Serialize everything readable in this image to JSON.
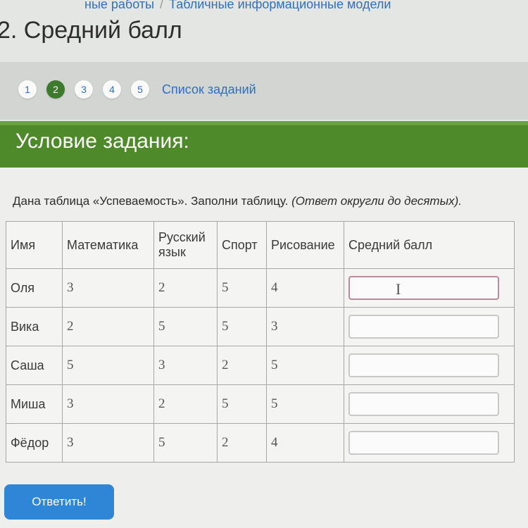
{
  "breadcrumb": {
    "prev": "ные работы",
    "separator": "/",
    "current": "Табличные информационные модели"
  },
  "page_title": "2. Средний балл",
  "pager": {
    "pages": [
      "1",
      "2",
      "3",
      "4",
      "5"
    ],
    "active_page": "2",
    "tasks_link": "Список заданий"
  },
  "section_header": "Условие задания:",
  "task": {
    "text": "Дана таблица «Успеваемость». Заполни таблицу.",
    "note": "(Ответ округли до десятых)."
  },
  "table": {
    "headers": [
      "Имя",
      "Математика",
      "Русский язык",
      "Спорт",
      "Рисование",
      "Средний балл"
    ],
    "rows": [
      {
        "name": "Оля",
        "values": [
          "3",
          "2",
          "5",
          "4"
        ],
        "answer": ""
      },
      {
        "name": "Вика",
        "values": [
          "2",
          "5",
          "5",
          "3"
        ],
        "answer": ""
      },
      {
        "name": "Саша",
        "values": [
          "5",
          "3",
          "2",
          "5"
        ],
        "answer": ""
      },
      {
        "name": "Миша",
        "values": [
          "3",
          "2",
          "5",
          "5"
        ],
        "answer": ""
      },
      {
        "name": "Фёдор",
        "values": [
          "3",
          "5",
          "2",
          "4"
        ],
        "answer": ""
      }
    ]
  },
  "submit_label": "Ответить!",
  "colors": {
    "accent_green": "#4f8a2a",
    "active_page": "#3d7a2c",
    "link_blue": "#2f6fc0",
    "button_blue": "#2f86d6"
  }
}
